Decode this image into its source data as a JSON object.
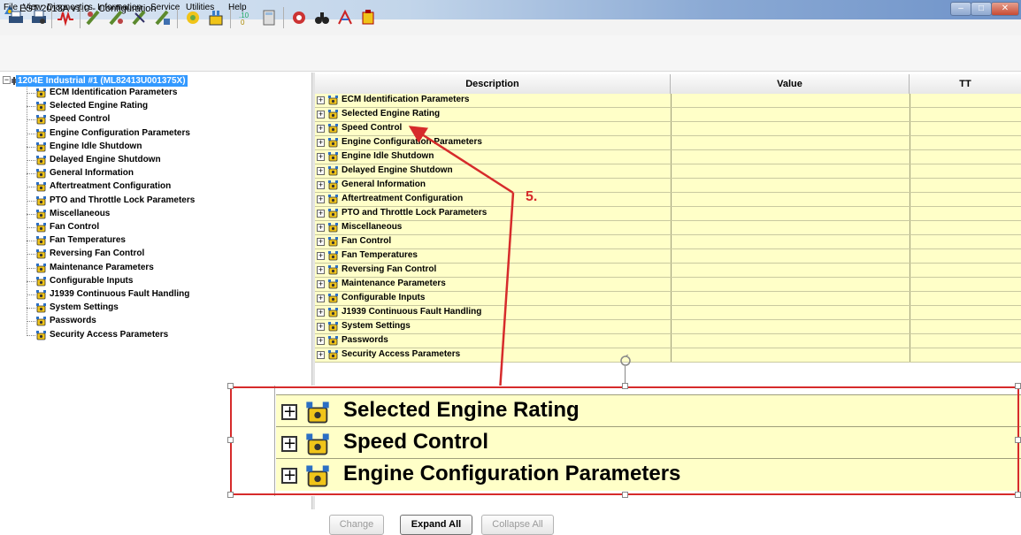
{
  "window": {
    "title": "EST 2013A v1.0 - Configuration",
    "min_glyph": "–",
    "max_glyph": "□",
    "close_glyph": "✕"
  },
  "menu": [
    "File",
    "View",
    "Diagnostics",
    "Information",
    "Service",
    "Utilities",
    "Help"
  ],
  "toolbar_icons": [
    "print-icon",
    "printer-settings-icon",
    "waveform-icon",
    "injector-icon-1",
    "injector-icon-2",
    "injector-icon-3",
    "injector-icon-4",
    "engine-settings-icon",
    "engine-config-icon",
    "diagnostic-codes-icon",
    "calculator-icon",
    "fault-icon",
    "binoculars-icon",
    "trip-icon",
    "module-icon"
  ],
  "tree": {
    "root_label": "1204E Industrial #1 (ML82413U001375X)",
    "items": [
      "ECM Identification Parameters",
      "Selected Engine Rating",
      "Speed Control",
      "Engine Configuration Parameters",
      "Engine Idle Shutdown",
      "Delayed Engine Shutdown",
      "General Information",
      "Aftertreatment Configuration",
      "PTO and Throttle Lock Parameters",
      "Miscellaneous",
      "Fan Control",
      "Fan Temperatures",
      "Reversing Fan Control",
      "Maintenance Parameters",
      "Configurable Inputs",
      "J1939 Continuous Fault Handling",
      "System Settings",
      "Passwords",
      "Security Access Parameters"
    ]
  },
  "grid": {
    "columns": [
      "Description",
      "Value",
      "TT"
    ],
    "rows": [
      "ECM Identification Parameters",
      "Selected Engine Rating",
      "Speed Control",
      "Engine Configuration Parameters",
      "Engine Idle Shutdown",
      "Delayed Engine Shutdown",
      "General Information",
      "Aftertreatment Configuration",
      "PTO and Throttle Lock Parameters",
      "Miscellaneous",
      "Fan Control",
      "Fan Temperatures",
      "Reversing Fan Control",
      "Maintenance Parameters",
      "Configurable Inputs",
      "J1939 Continuous Fault Handling",
      "System Settings",
      "Passwords",
      "Security Access Parameters"
    ],
    "expand_glyph": "⊞"
  },
  "zoom_callout": {
    "rows": [
      "Selected Engine Rating",
      "Speed Control",
      "Engine Configuration Parameters"
    ]
  },
  "annotation": {
    "label": "5.",
    "color": "#d62b2b"
  },
  "buttons": {
    "change": "Change",
    "expand_all": "Expand All",
    "collapse_all": "Collapse All"
  },
  "colors": {
    "row_background": "#ffffc8",
    "selection": "#3399ff",
    "accent_red": "#d62b2b"
  }
}
